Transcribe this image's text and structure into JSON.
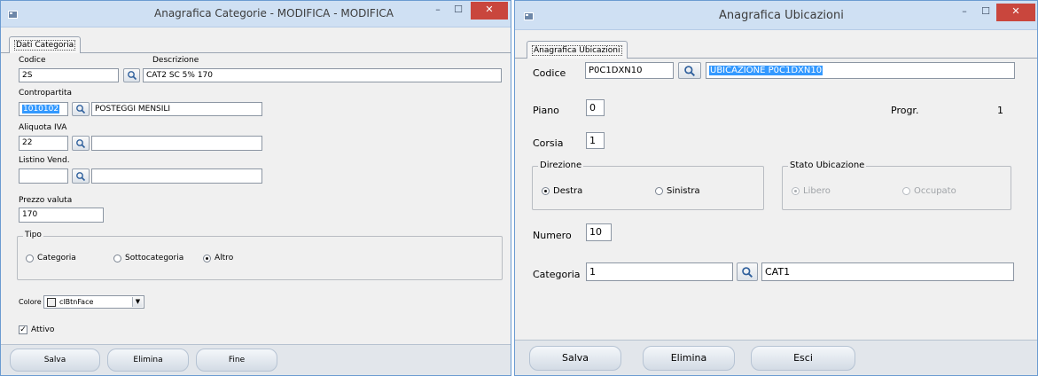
{
  "window1": {
    "title": "Anagrafica Categorie - MODIFICA - MODIFICA",
    "controls": {
      "minimize": "–",
      "maximize": "☐",
      "close": "✕"
    },
    "tab": "Dati Categoria",
    "fields": {
      "codice": {
        "label": "Codice",
        "value": "2S"
      },
      "descrizione": {
        "label": "Descrizione",
        "value": "CAT2 SC 5% 170"
      },
      "contropartita": {
        "label": "Contropartita",
        "value": "1010102",
        "desc": "POSTEGGI MENSILI"
      },
      "aliquota_iva": {
        "label": "Aliquota IVA",
        "value": "22",
        "desc": ""
      },
      "listino_vend": {
        "label": "Listino Vend.",
        "value": "",
        "desc": ""
      },
      "prezzo_valuta": {
        "label": "Prezzo valuta",
        "value": "170"
      }
    },
    "tipo": {
      "label": "Tipo",
      "options": [
        "Categoria",
        "Sottocategoria",
        "Altro"
      ],
      "selected": "Altro"
    },
    "colore": {
      "label": "Colore",
      "value": "clBtnFace"
    },
    "attivo": {
      "label": "Attivo",
      "checked": true
    },
    "buttons": {
      "salva": "Salva",
      "elimina": "Elimina",
      "fine": "Fine"
    }
  },
  "window2": {
    "title": "Anagrafica Ubicazioni",
    "controls": {
      "minimize": "–",
      "maximize": "☐",
      "close": "✕"
    },
    "tab": "Anagrafica Ubicazioni",
    "fields": {
      "codice": {
        "label": "Codice",
        "value": "P0C1DXN10",
        "desc": "UBICAZIONE P0C1DXN10"
      },
      "piano": {
        "label": "Piano",
        "value": "0"
      },
      "progr": {
        "label": "Progr.",
        "value": "1"
      },
      "corsia": {
        "label": "Corsia",
        "value": "1"
      },
      "numero": {
        "label": "Numero",
        "value": "10"
      },
      "categoria": {
        "label": "Categoria",
        "value": "1",
        "desc": "CAT1"
      }
    },
    "direzione": {
      "label": "Direzione",
      "options": [
        "Destra",
        "Sinistra"
      ],
      "selected": "Destra"
    },
    "stato_ubicazione": {
      "label": "Stato Ubicazione",
      "options": [
        "Libero",
        "Occupato"
      ],
      "selected": "Libero",
      "enabled": false
    },
    "buttons": {
      "salva": "Salva",
      "elimina": "Elimina",
      "esci": "Esci"
    }
  }
}
